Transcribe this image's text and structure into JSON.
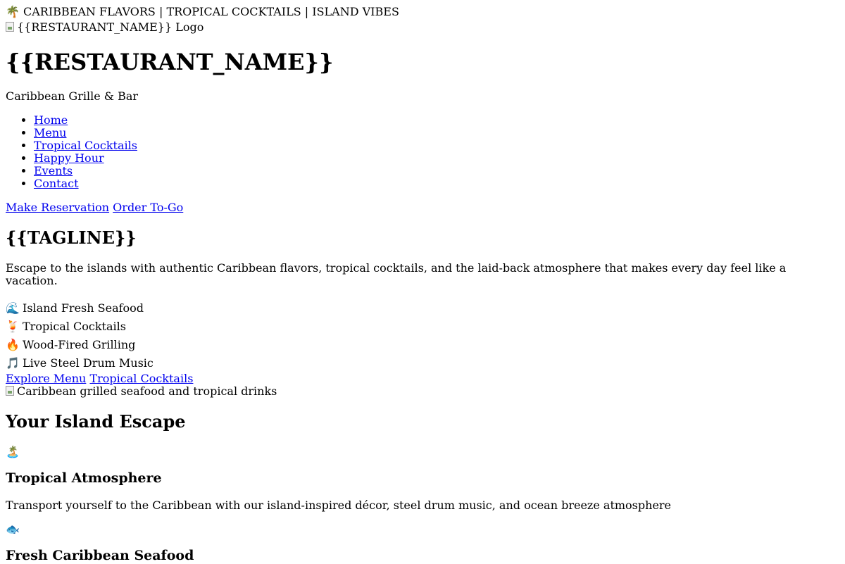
{
  "topbar": {
    "icon": "palm-tree-icon",
    "text": "🌴 CARIBBEAN FLAVORS | TROPICAL COCKTAILS | ISLAND VIBES"
  },
  "logo": {
    "alt": "{{RESTAURANT_NAME}} Logo"
  },
  "brand": {
    "name": "{{RESTAURANT_NAME}}",
    "subtitle": "Caribbean Grille & Bar"
  },
  "nav": {
    "items": [
      {
        "label": "Home"
      },
      {
        "label": "Menu"
      },
      {
        "label": "Tropical Cocktails"
      },
      {
        "label": "Happy Hour"
      },
      {
        "label": "Events"
      },
      {
        "label": "Contact"
      }
    ]
  },
  "cta": {
    "reservation": "Make Reservation",
    "order": "Order To-Go"
  },
  "hero": {
    "tagline": "{{TAGLINE}}",
    "intro": "Escape to the islands with authentic Caribbean flavors, tropical cocktails, and the laid-back atmosphere that makes every day feel like a vacation.",
    "features": [
      {
        "icon": "wave-icon",
        "emoji": "🌊",
        "label": "Island Fresh Seafood"
      },
      {
        "icon": "tropical-drink-icon",
        "emoji": "🍹",
        "label": "Tropical Cocktails"
      },
      {
        "icon": "fire-icon",
        "emoji": "🔥",
        "label": "Wood-Fired Grilling"
      },
      {
        "icon": "music-note-icon",
        "emoji": "🎵",
        "label": "Live Steel Drum Music"
      }
    ],
    "buttons": {
      "explore": "Explore Menu",
      "cocktails": "Tropical Cocktails"
    },
    "image_alt": "Caribbean grilled seafood and tropical drinks"
  },
  "escape": {
    "heading": "Your Island Escape",
    "cards": [
      {
        "icon": "desert-island-icon",
        "emoji": "🏝️",
        "title": "Tropical Atmosphere",
        "text": "Transport yourself to the Caribbean with our island-inspired décor, steel drum music, and ocean breeze atmosphere"
      },
      {
        "icon": "fish-icon",
        "emoji": "🐟",
        "title": "Fresh Caribbean Seafood",
        "text": ""
      }
    ]
  }
}
